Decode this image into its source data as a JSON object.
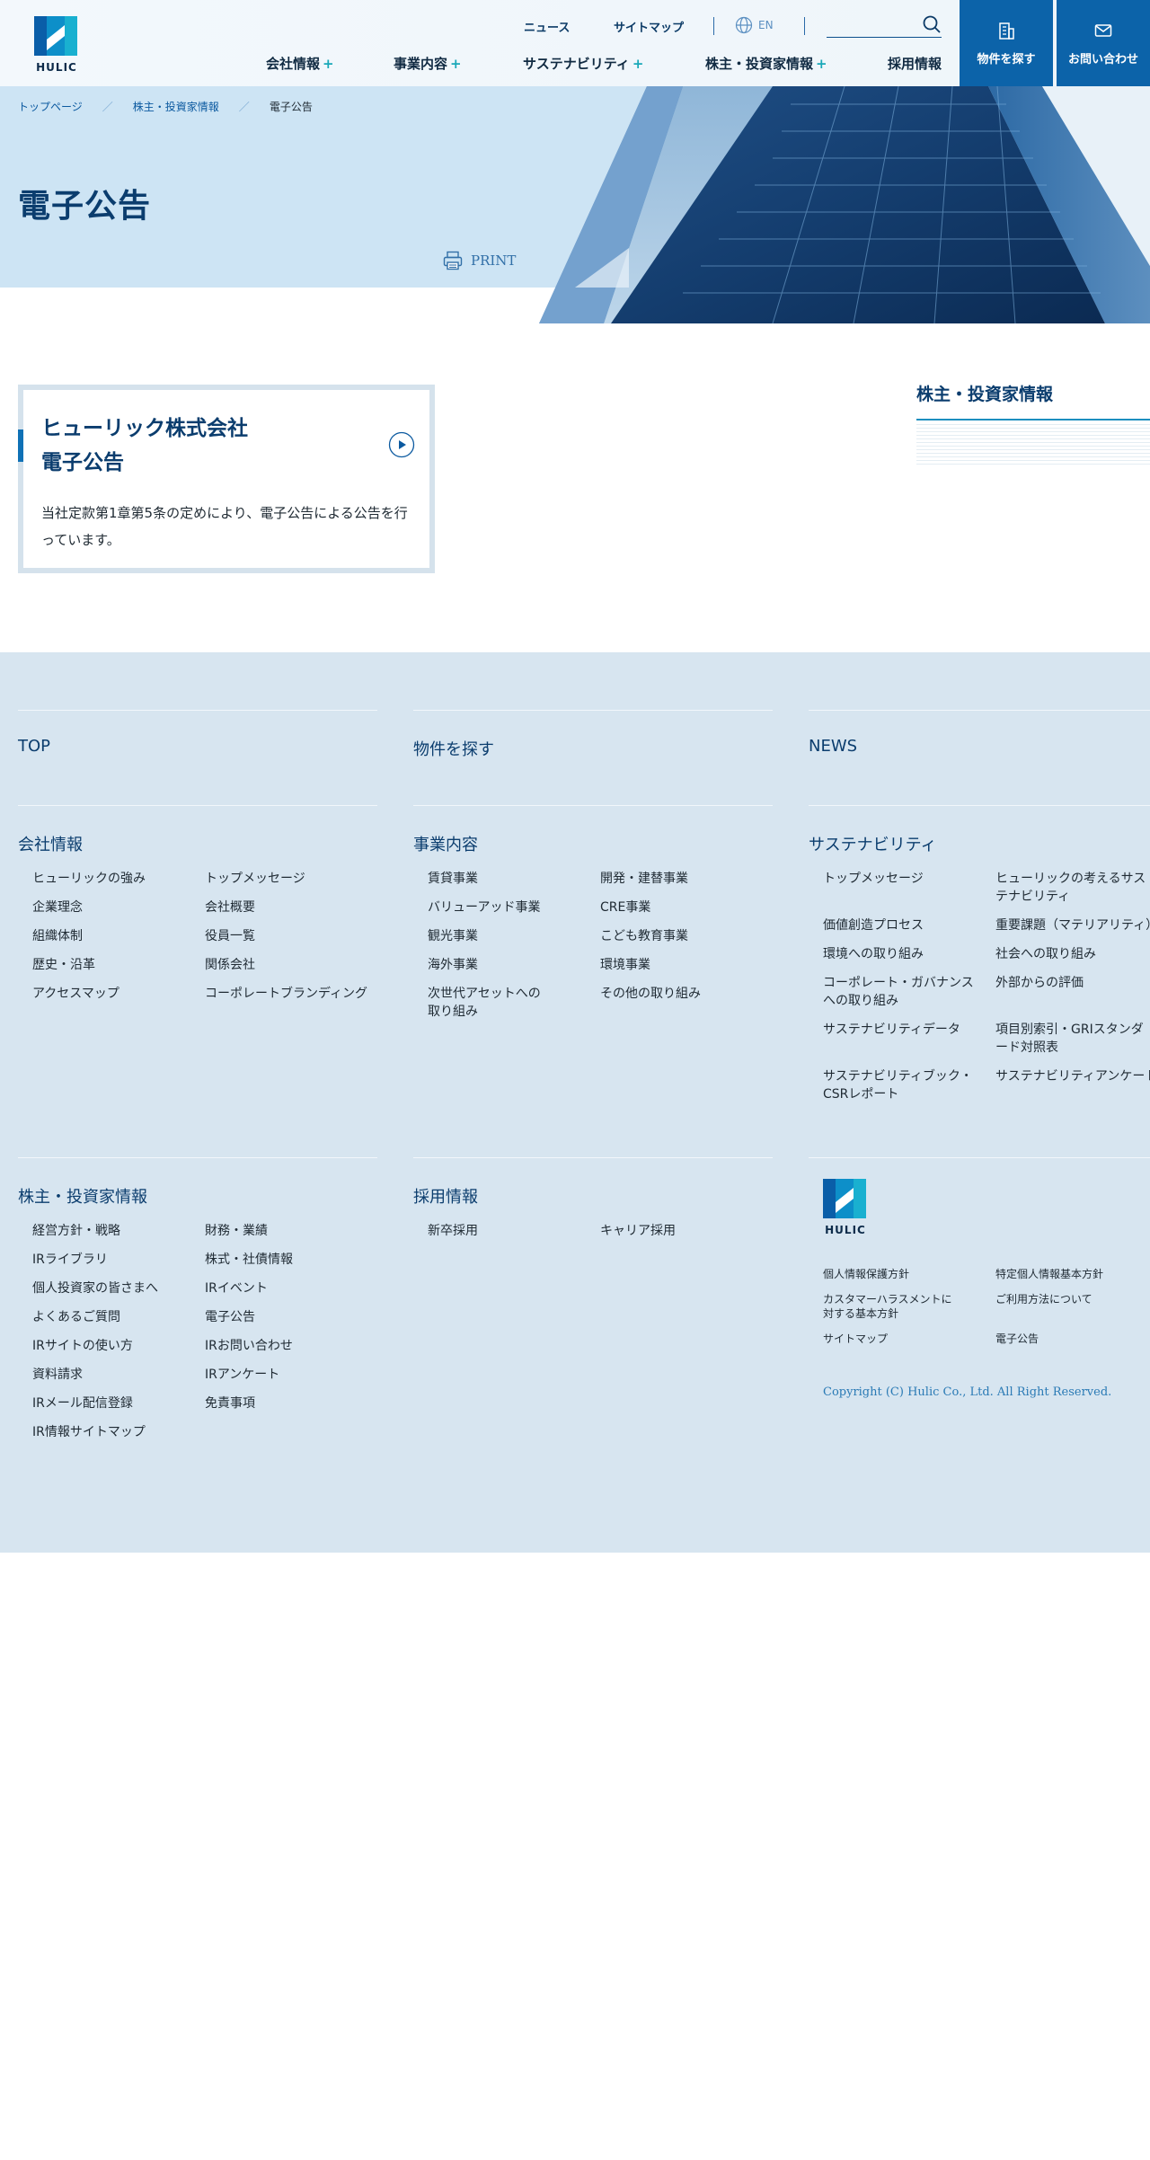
{
  "header": {
    "logo_text": "HULIC",
    "util_news": "ニュース",
    "util_sitemap": "サイトマップ",
    "util_lang": "EN",
    "search_placeholder": "",
    "nav": {
      "company": "会社情報",
      "business": "事業内容",
      "sustainability": "サステナビリティ",
      "ir": "株主・投資家情報",
      "recruit": "採用情報",
      "plus": "+"
    },
    "find_property": "物件を探す",
    "contact": "お問い合わせ"
  },
  "hero": {
    "breadcrumb": [
      "トップページ",
      "株主・投資家情報",
      "電子公告"
    ],
    "breadcrumb_sep": "／",
    "title": "電子公告",
    "print_label": "PRINT"
  },
  "card": {
    "title_line1": "ヒューリック株式会社",
    "title_line2": "電子公告",
    "text": "当社定款第1章第5条の定めにより、電子公告による公告を行っています。"
  },
  "sidebar": {
    "title": "株主・投資家情報"
  },
  "footer": {
    "top": "TOP",
    "find_property": "物件を探す",
    "news": "NEWS",
    "company": {
      "heading": "会社情報",
      "links": [
        "ヒューリックの強み",
        "トップメッセージ",
        "企業理念",
        "会社概要",
        "組織体制",
        "役員一覧",
        "歴史・沿革",
        "関係会社",
        "アクセスマップ",
        "コーポレートブランディング"
      ]
    },
    "business": {
      "heading": "事業内容",
      "links": [
        "賃貸事業",
        "開発・建替事業",
        "バリューアッド事業",
        "CRE事業",
        "観光事業",
        "こども教育事業",
        "海外事業",
        "環境事業",
        "次世代アセットへの取り組み",
        "その他の取り組み"
      ]
    },
    "sustainability": {
      "heading": "サステナビリティ",
      "links": [
        "トップメッセージ",
        "ヒューリックの考えるサステナビリティ",
        "価値創造プロセス",
        "重要課題（マテリアリティ）",
        "環境への取り組み",
        "社会への取り組み",
        "コーポレート・ガバナンスへの取り組み",
        "外部からの評価",
        "サステナビリティデータ",
        "項目別索引・GRIスタンダード対照表",
        "サステナビリティブック・CSRレポート",
        "サステナビリティアンケート"
      ]
    },
    "ir": {
      "heading": "株主・投資家情報",
      "links": [
        "経営方針・戦略",
        "財務・業績",
        "IRライブラリ",
        "株式・社債情報",
        "個人投資家の皆さまへ",
        "IRイベント",
        "よくあるご質問",
        "電子公告",
        "IRサイトの使い方",
        "IRお問い合わせ",
        "資料請求",
        "IRアンケート",
        "IRメール配信登録",
        "免責事項",
        "IR情報サイトマップ"
      ]
    },
    "recruit": {
      "heading": "採用情報",
      "links": [
        "新卒採用",
        "キャリア採用"
      ]
    },
    "logo_text": "HULIC",
    "legal": [
      "個人情報保護方針",
      "特定個人情報基本方針",
      "カスタマーハラスメントに対する基本方針",
      "ご利用方法について",
      "サイトマップ",
      "電子公告"
    ],
    "copyright": "Copyright (C) Hulic Co., Ltd. All Right Reserved."
  }
}
